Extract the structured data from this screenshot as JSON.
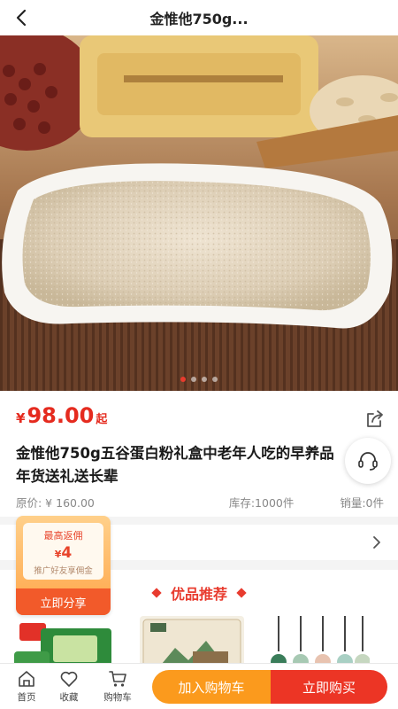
{
  "header": {
    "title": "金惟他750g...",
    "back_icon": "chevron-left-icon"
  },
  "gallery": {
    "slide_count": 4,
    "active_index": 0
  },
  "product": {
    "currency": "¥",
    "price": "98.00",
    "price_suffix": "起",
    "title": "金惟他750g五谷蛋白粉礼盒中老年人吃的早养品年货送礼送长辈",
    "original_price": "原价: ¥ 160.00",
    "stock": "库存:1000件",
    "sales": "销量:0件"
  },
  "promo": {
    "label": "最高返佣",
    "currency": "¥",
    "amount": "4",
    "sub": "推广好友享佣金",
    "button": "立即分享"
  },
  "recommend": {
    "title": "优品推荐"
  },
  "bottom_nav": {
    "home": "首页",
    "favorite": "收藏",
    "cart": "购物车",
    "add_to_cart": "加入购物车",
    "buy_now": "立即购买"
  },
  "colors": {
    "accent": "#e83b2e",
    "orange": "#fb9a1d",
    "price": "#e52b1f"
  }
}
